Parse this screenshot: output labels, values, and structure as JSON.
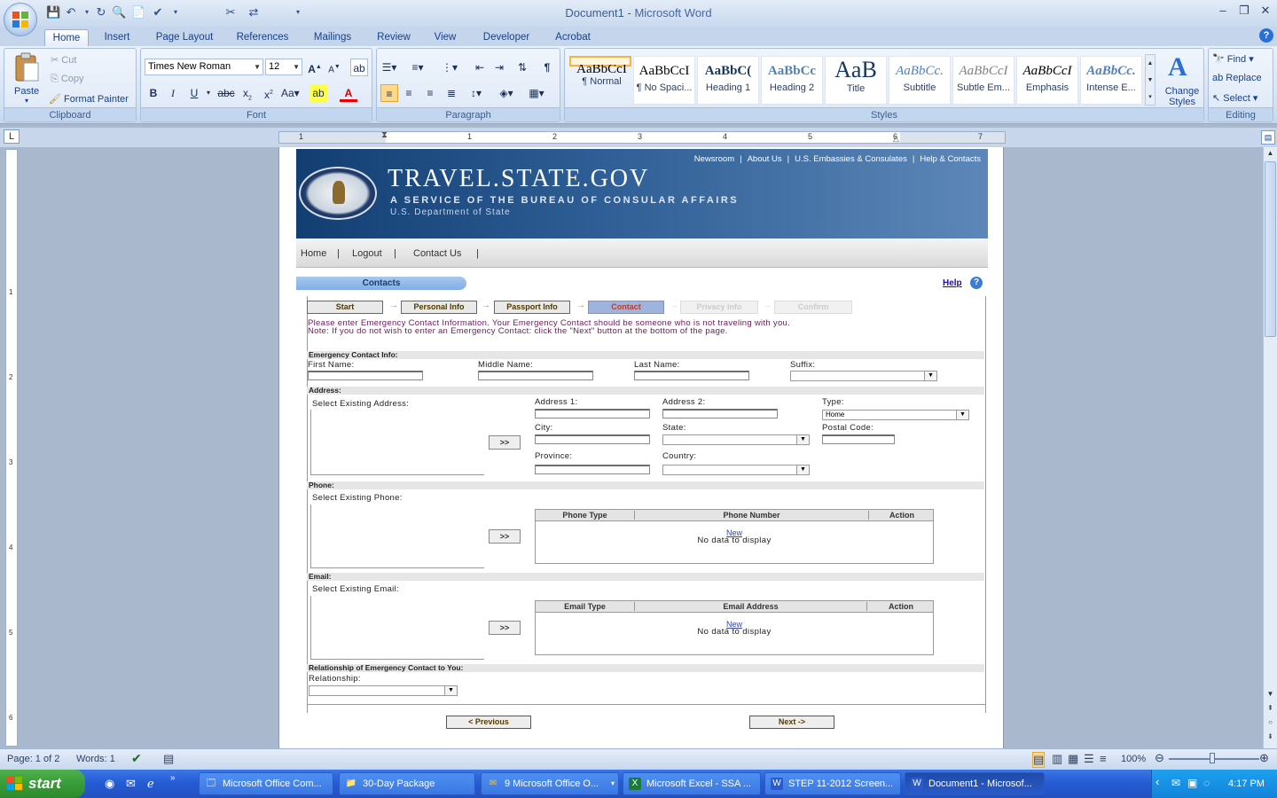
{
  "window": {
    "doc_name": "Document1",
    "title_sep": " - ",
    "app_name": "Microsoft Word",
    "controls": [
      "–",
      "❐",
      "✕"
    ]
  },
  "qat": [
    "💾",
    "↶",
    "▾",
    "↻",
    "🔍",
    "📄",
    "✔",
    "▾",
    "✂",
    "⇄",
    "▾"
  ],
  "tabs": [
    {
      "label": "Home",
      "active": true
    },
    {
      "label": "Insert"
    },
    {
      "label": "Page Layout"
    },
    {
      "label": "References"
    },
    {
      "label": "Mailings"
    },
    {
      "label": "Review"
    },
    {
      "label": "View"
    },
    {
      "label": "Developer"
    },
    {
      "label": "Acrobat"
    }
  ],
  "ribbon": {
    "clipboard": {
      "label": "Clipboard",
      "paste": "Paste",
      "cut": "Cut",
      "copy": "Copy",
      "format_painter": "Format Painter"
    },
    "font": {
      "label": "Font",
      "font_name": "Times New Roman",
      "font_size": "12"
    },
    "paragraph": {
      "label": "Paragraph"
    },
    "styles": {
      "label": "Styles",
      "items": [
        {
          "preview": "AaBbCcI",
          "name": "¶ Normal"
        },
        {
          "preview": "AaBbCcI",
          "name": "¶ No Spaci..."
        },
        {
          "preview": "AaBbC(",
          "name": "Heading 1"
        },
        {
          "preview": "AaBbCc",
          "name": "Heading 2"
        },
        {
          "preview": "AaB",
          "name": "Title"
        },
        {
          "preview": "AaBbCc.",
          "name": "Subtitle"
        },
        {
          "preview": "AaBbCcI",
          "name": "Subtle Em..."
        },
        {
          "preview": "AaBbCcI",
          "name": "Emphasis"
        },
        {
          "preview": "AaBbCc.",
          "name": "Intense E..."
        }
      ],
      "change_styles": "Change Styles"
    },
    "editing": {
      "label": "Editing",
      "find": "Find",
      "replace": "Replace",
      "select": "Select"
    }
  },
  "ruler_numbers": [
    "1",
    "1",
    "2",
    "3",
    "4",
    "5",
    "6",
    "7"
  ],
  "vruler_numbers": [
    "1",
    "2",
    "3",
    "4",
    "5",
    "6"
  ],
  "web": {
    "site_title": "TRAVEL.STATE.GOV",
    "service": "A SERVICE OF THE BUREAU OF CONSULAR AFFAIRS",
    "department": "U.S. Department of State",
    "top_links": [
      "Newsroom",
      "|",
      "About Us",
      "|",
      "U.S. Embassies & Consulates",
      "|",
      "Help & Contacts"
    ],
    "nav": [
      "Home",
      "|",
      "Logout",
      "|",
      "Contact Us",
      "|"
    ],
    "section_tab": "Contacts",
    "help": "Help",
    "steps": [
      {
        "label": "Start",
        "state": "done"
      },
      {
        "label": "Personal Info",
        "state": "done"
      },
      {
        "label": "Passport Info",
        "state": "done"
      },
      {
        "label": "Contact",
        "state": "current"
      },
      {
        "label": "Privacy Info",
        "state": "disabled"
      },
      {
        "label": "Confirm",
        "state": "disabled"
      }
    ],
    "note1": "Please enter Emergency Contact Information. Your Emergency Contact should be someone who is not traveling with you.",
    "note2": "Note: If you do not wish to enter an Emergency Contact: click the \"Next\" button at the bottom of the page.",
    "emergency": {
      "header": "Emergency Contact Info:",
      "first": "First Name:",
      "middle": "Middle Name:",
      "last": "Last Name:",
      "suffix": "Suffix:"
    },
    "address": {
      "header": "Address:",
      "select_existing": "Select Existing Address:",
      "addr1": "Address 1:",
      "addr2": "Address 2:",
      "type": "Type:",
      "type_value": "Home",
      "city": "City:",
      "state": "State:",
      "postal": "Postal Code:",
      "province": "Province:",
      "country": "Country:"
    },
    "phone": {
      "header": "Phone:",
      "select_existing": "Select Existing Phone:",
      "col_type": "Phone Type",
      "col_number": "Phone Number",
      "col_action": "Action",
      "new": "New",
      "empty": "No data to display"
    },
    "email": {
      "header": "Email:",
      "select_existing": "Select Existing Email:",
      "col_type": "Email Type",
      "col_address": "Email Address",
      "col_action": "Action",
      "new": "New",
      "empty": "No data to display"
    },
    "relationship": {
      "header": "Relationship of Emergency Contact to You:",
      "label": "Relationship:"
    },
    "move_button": ">>",
    "previous": "< Previous",
    "next": "Next ->"
  },
  "status": {
    "page": "Page: 1 of 2",
    "words": "Words: 1",
    "zoom": "100%"
  },
  "taskbar": {
    "start": "start",
    "items": [
      {
        "label": "Microsoft Office Com...",
        "icon": "🗔"
      },
      {
        "label": "30-Day Package",
        "icon": "📁"
      },
      {
        "label": "9 Microsoft Office O...",
        "icon": "✉"
      },
      {
        "label": "Microsoft Excel - SSA ...",
        "icon": "X"
      },
      {
        "label": "STEP 11-2012 Screen...",
        "icon": "W"
      },
      {
        "label": "Document1 - Microsof...",
        "icon": "W",
        "active": true
      }
    ],
    "clock": "4:17 PM"
  }
}
